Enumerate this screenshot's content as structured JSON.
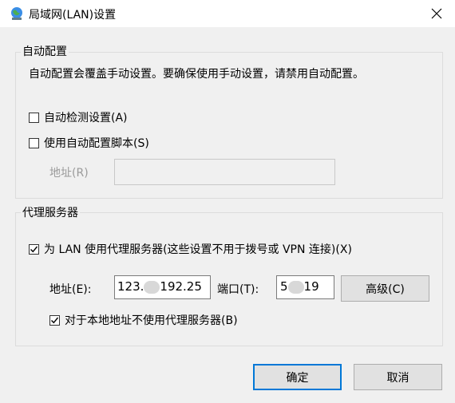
{
  "window": {
    "title": "局域网(LAN)设置",
    "icon": "globe-network-icon"
  },
  "auto_config": {
    "group_title": "自动配置",
    "description": "自动配置会覆盖手动设置。要确保使用手动设置，请禁用自动配置。",
    "auto_detect_label": "自动检测设置(A)",
    "auto_detect_checked": false,
    "use_script_label": "使用自动配置脚本(S)",
    "use_script_checked": false,
    "address_label": "地址(R)",
    "address_value": ""
  },
  "proxy": {
    "group_title": "代理服务器",
    "use_proxy_label": "为 LAN 使用代理服务器(这些设置不用于拨号或 VPN 连接)(X)",
    "use_proxy_checked": true,
    "address_label": "地址(E):",
    "address_prefix": "123.",
    "address_suffix": "192.25",
    "port_label": "端口(T):",
    "port_prefix": "5",
    "port_suffix": "19",
    "advanced_label": "高级(C)",
    "bypass_label": "对于本地地址不使用代理服务器(B)",
    "bypass_checked": true
  },
  "buttons": {
    "ok": "确定",
    "cancel": "取消"
  }
}
